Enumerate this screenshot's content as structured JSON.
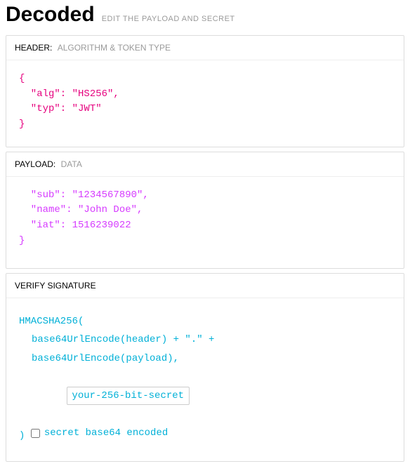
{
  "title": "Decoded",
  "subtitle": "EDIT THE PAYLOAD AND SECRET",
  "header_section": {
    "label": "HEADER:",
    "hint": "ALGORITHM & TOKEN TYPE",
    "code": "{\n  \"alg\": \"HS256\",\n  \"typ\": \"JWT\"\n}"
  },
  "payload_section": {
    "label": "PAYLOAD:",
    "hint": "DATA",
    "code_open": "",
    "code_lines": [
      "  \"sub\": \"1234567890\",",
      "  \"name\": \"John Doe\",",
      "  \"iat\": 1516239022"
    ],
    "code_close": "}"
  },
  "verify_section": {
    "label": "VERIFY SIGNATURE",
    "fn_open": "HMACSHA256(",
    "line1": "base64UrlEncode(header) + \".\" +",
    "line2": "base64UrlEncode(payload),",
    "secret_value": "your-256-bit-secret",
    "fn_close": ")",
    "checkbox_label": "secret base64 encoded",
    "checkbox_checked": false
  }
}
